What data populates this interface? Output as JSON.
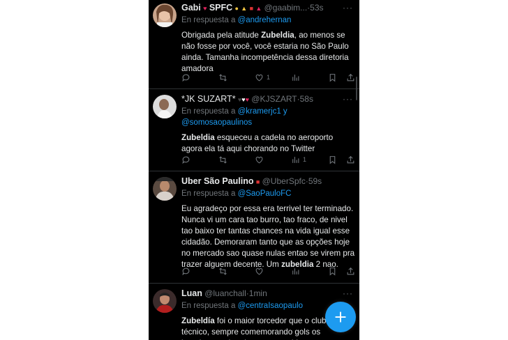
{
  "timeline": {
    "tweets": [
      {
        "name": "Gabi",
        "name_suffix": "SPFC",
        "handle": "@gaabim...",
        "time": "53s",
        "reply_prefix": "En respuesta a",
        "reply_to": "@andrehernan",
        "reply_to_2": "",
        "body_html_parts": [
          "Obrigada pela atitude ",
          "Zubeldia",
          ", ao menos se não fosse por você, você estaria no São Paulo ainda. Tamanha incompetência dessa diretoria amadora"
        ],
        "likes": "1",
        "views": ""
      },
      {
        "name": "*JK SUZART*",
        "name_suffix": "",
        "handle": "@KJSZART",
        "time": "58s",
        "reply_prefix": "En respuesta a",
        "reply_to": "@kramerjc1 y",
        "reply_to_2": "@somosaopaulinos",
        "body_html_parts": [
          "Zubeldia",
          " esqueceu a cadela no aeroporto agora ela tá aqui chorando no Twitter",
          ""
        ],
        "likes": "",
        "views": "1"
      },
      {
        "name": "Uber São Paulino",
        "name_suffix": "",
        "handle": "@UberSpfc",
        "time": "59s",
        "reply_prefix": "En respuesta a",
        "reply_to": "@SaoPauloFC",
        "reply_to_2": "",
        "body_html_parts": [
          "Eu agradeço por essa era terrivel ter terminado. Nunca vi um cara tao burro, tao fraco, de nivel tao baixo ter tantas chances na vida igual esse cidadão. Demoraram tanto que as opções hoje no mercado sao quase nulas entao se virem pra trazer alguem decente. Um ",
          "zubeldia",
          " 2 nao."
        ],
        "likes": "",
        "views": ""
      },
      {
        "name": "Luan",
        "name_suffix": "",
        "handle": "@luanchall",
        "time": "1min",
        "reply_prefix": "En respuesta a",
        "reply_to": "@centraIsaopaulo",
        "reply_to_2": "",
        "body_html_parts": [
          "Zubeldía",
          " foi o maior torcedor que o clube como técnico, sempre comemorando gols os jogadores, gritando contra o arbitragem",
          ""
        ],
        "likes": "",
        "views": ""
      }
    ]
  },
  "fab": {
    "icon": "plus-icon"
  },
  "colors": {
    "background": "#000000",
    "accent": "#1d9bf0",
    "muted": "#71767b",
    "text": "#e7e9ea"
  }
}
